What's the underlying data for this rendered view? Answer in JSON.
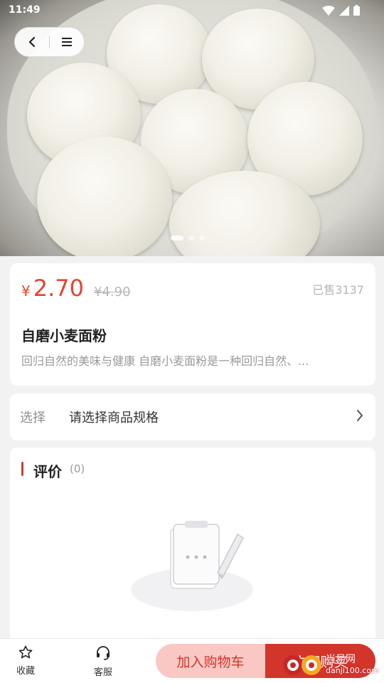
{
  "status_bar": {
    "time": "11:49"
  },
  "hero": {
    "slide_count": 3,
    "active_slide": 1
  },
  "product": {
    "currency": "¥",
    "price": "2.70",
    "original_price": "¥4.90",
    "sold": "已售3137",
    "title": "自磨小麦面粉",
    "description": "回归自然的美味与健康 自磨小麦面粉是一种回归自然、..."
  },
  "spec": {
    "label": "选择",
    "value": "请选择商品规格"
  },
  "reviews": {
    "title": "评价",
    "count": "(0)"
  },
  "bottom_bar": {
    "favorite_label": "收藏",
    "service_label": "客服",
    "cart_button": "加入购物车",
    "buy_button": "立即购买"
  },
  "watermark": {
    "line1": "当易网",
    "line2": "danji100.com"
  },
  "colors": {
    "accent": "#d3352b",
    "price": "#e8432e",
    "cart_bg": "#f9c8c4"
  }
}
